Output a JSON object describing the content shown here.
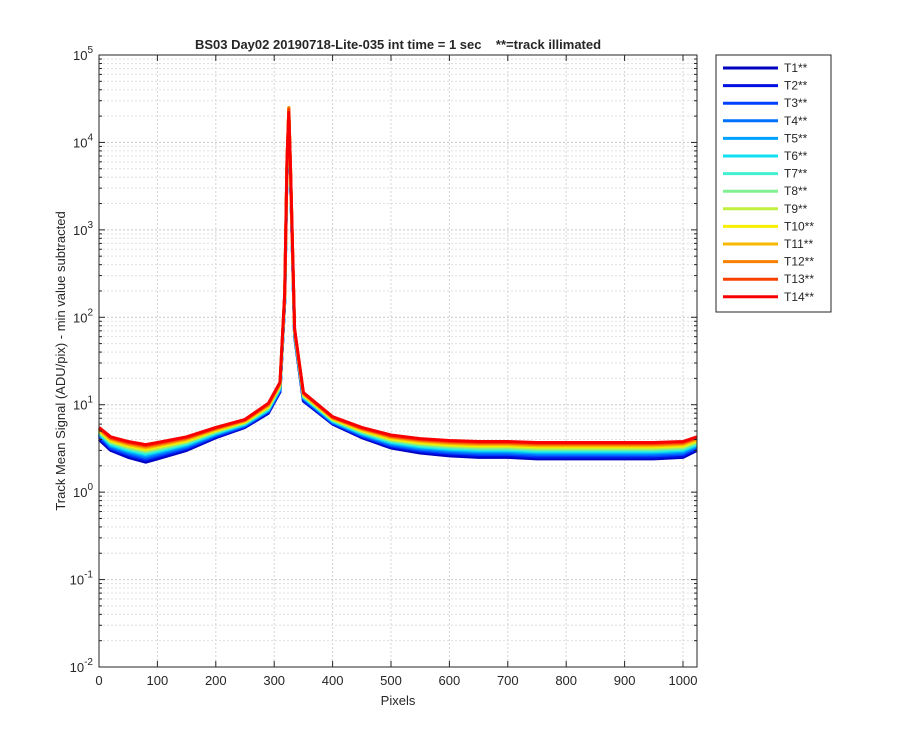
{
  "chart_data": {
    "type": "line",
    "title": "BS03 Day02 20190718-Lite-035 int time = 1 sec    **=track illimated",
    "xlabel": "Pixels",
    "ylabel": "Track Mean Signal (ADU/pix) - min value subtracted",
    "xlim": [
      0,
      1024
    ],
    "ylim": [
      0.01,
      100000
    ],
    "yscale": "log",
    "grid": true,
    "minor_grid": true,
    "legend_position": "outside-right-top",
    "x_ticks": [
      {
        "value": 0,
        "label": "0"
      },
      {
        "value": 100,
        "label": "100"
      },
      {
        "value": 200,
        "label": "200"
      },
      {
        "value": 300,
        "label": "300"
      },
      {
        "value": 400,
        "label": "400"
      },
      {
        "value": 500,
        "label": "500"
      },
      {
        "value": 600,
        "label": "600"
      },
      {
        "value": 700,
        "label": "700"
      },
      {
        "value": 800,
        "label": "800"
      },
      {
        "value": 900,
        "label": "900"
      },
      {
        "value": 1000,
        "label": "1000"
      }
    ],
    "y_ticks": [
      {
        "value": 0.01,
        "base": "10",
        "exp": "-2"
      },
      {
        "value": 0.1,
        "base": "10",
        "exp": "-1"
      },
      {
        "value": 1,
        "base": "10",
        "exp": "0"
      },
      {
        "value": 10,
        "base": "10",
        "exp": "1"
      },
      {
        "value": 100,
        "base": "10",
        "exp": "2"
      },
      {
        "value": 1000,
        "base": "10",
        "exp": "3"
      },
      {
        "value": 10000,
        "base": "10",
        "exp": "4"
      },
      {
        "value": 100000,
        "base": "10",
        "exp": "5"
      }
    ],
    "series": [
      {
        "name": "T1**",
        "color": "#0000bf",
        "x": [
          0,
          20,
          50,
          80,
          100,
          150,
          200,
          250,
          290,
          310,
          318,
          322,
          325,
          328,
          335,
          350,
          400,
          450,
          500,
          550,
          600,
          650,
          700,
          750,
          800,
          850,
          900,
          950,
          1000,
          1024
        ],
        "y": [
          4,
          3,
          2.5,
          2.2,
          2.4,
          3,
          4.2,
          5.5,
          8,
          14,
          150,
          5000,
          21000,
          4000,
          60,
          11,
          6,
          4.2,
          3.2,
          2.8,
          2.6,
          2.5,
          2.5,
          2.4,
          2.4,
          2.4,
          2.4,
          2.4,
          2.5,
          3
        ]
      },
      {
        "name": "T2**",
        "color": "#0010e0",
        "x": [
          0,
          20,
          50,
          80,
          100,
          150,
          200,
          250,
          290,
          310,
          318,
          322,
          325,
          328,
          335,
          350,
          400,
          450,
          500,
          550,
          600,
          650,
          700,
          750,
          800,
          850,
          900,
          950,
          1000,
          1024
        ],
        "y": [
          4.2,
          3.1,
          2.6,
          2.3,
          2.5,
          3.1,
          4.3,
          5.6,
          8.2,
          14,
          150,
          5200,
          21500,
          4100,
          62,
          11,
          6.1,
          4.3,
          3.3,
          2.9,
          2.7,
          2.6,
          2.6,
          2.5,
          2.5,
          2.5,
          2.5,
          2.5,
          2.6,
          3.1
        ]
      },
      {
        "name": "T3**",
        "color": "#0040ff",
        "x": [
          0,
          20,
          50,
          80,
          100,
          150,
          200,
          250,
          290,
          310,
          318,
          322,
          325,
          328,
          335,
          350,
          400,
          450,
          500,
          550,
          600,
          650,
          700,
          750,
          800,
          850,
          900,
          950,
          1000,
          1024
        ],
        "y": [
          4.4,
          3.2,
          2.7,
          2.4,
          2.6,
          3.2,
          4.4,
          5.7,
          8.4,
          14.5,
          155,
          5300,
          22000,
          4200,
          63,
          11.5,
          6.2,
          4.4,
          3.4,
          3,
          2.8,
          2.7,
          2.7,
          2.6,
          2.6,
          2.6,
          2.6,
          2.6,
          2.7,
          3.2
        ]
      },
      {
        "name": "T4**",
        "color": "#0070ff",
        "x": [
          0,
          20,
          50,
          80,
          100,
          150,
          200,
          250,
          290,
          310,
          318,
          322,
          325,
          328,
          335,
          350,
          400,
          450,
          500,
          550,
          600,
          650,
          700,
          750,
          800,
          850,
          900,
          950,
          1000,
          1024
        ],
        "y": [
          4.5,
          3.3,
          2.8,
          2.5,
          2.7,
          3.3,
          4.5,
          5.8,
          8.5,
          15,
          160,
          5400,
          22500,
          4300,
          64,
          12,
          6.3,
          4.5,
          3.5,
          3.1,
          2.9,
          2.8,
          2.8,
          2.7,
          2.7,
          2.7,
          2.7,
          2.7,
          2.8,
          3.3
        ]
      },
      {
        "name": "T5**",
        "color": "#00a0ff",
        "x": [
          0,
          20,
          50,
          80,
          100,
          150,
          200,
          250,
          290,
          310,
          318,
          322,
          325,
          328,
          335,
          350,
          400,
          450,
          500,
          550,
          600,
          650,
          700,
          750,
          800,
          850,
          900,
          950,
          1000,
          1024
        ],
        "y": [
          4.6,
          3.4,
          2.9,
          2.6,
          2.8,
          3.4,
          4.6,
          5.9,
          8.6,
          15,
          160,
          5500,
          23000,
          4400,
          65,
          12,
          6.4,
          4.6,
          3.6,
          3.2,
          3,
          2.9,
          2.9,
          2.8,
          2.8,
          2.8,
          2.8,
          2.8,
          2.9,
          3.4
        ]
      },
      {
        "name": "T6**",
        "color": "#10e0f0",
        "x": [
          0,
          20,
          50,
          80,
          100,
          150,
          200,
          250,
          290,
          310,
          318,
          322,
          325,
          328,
          335,
          350,
          400,
          450,
          500,
          550,
          600,
          650,
          700,
          750,
          800,
          850,
          900,
          950,
          1000,
          1024
        ],
        "y": [
          4.7,
          3.5,
          3,
          2.7,
          2.9,
          3.5,
          4.7,
          6,
          8.8,
          15.5,
          165,
          5600,
          23000,
          4500,
          66,
          12.2,
          6.5,
          4.7,
          3.7,
          3.3,
          3.1,
          3,
          3,
          2.9,
          2.9,
          2.9,
          2.9,
          2.9,
          3,
          3.5
        ]
      },
      {
        "name": "T7**",
        "color": "#40f0d0",
        "x": [
          0,
          20,
          50,
          80,
          100,
          150,
          200,
          250,
          290,
          310,
          318,
          322,
          325,
          328,
          335,
          350,
          400,
          450,
          500,
          550,
          600,
          650,
          700,
          750,
          800,
          850,
          900,
          950,
          1000,
          1024
        ],
        "y": [
          4.8,
          3.6,
          3.1,
          2.8,
          3,
          3.6,
          4.8,
          6.1,
          9,
          16,
          170,
          5700,
          23500,
          4600,
          67,
          12.4,
          6.6,
          4.8,
          3.8,
          3.4,
          3.2,
          3.1,
          3.1,
          3,
          3,
          3,
          3,
          3,
          3.1,
          3.6
        ]
      },
      {
        "name": "T8**",
        "color": "#80f090",
        "x": [
          0,
          20,
          50,
          80,
          100,
          150,
          200,
          250,
          290,
          310,
          318,
          322,
          325,
          328,
          335,
          350,
          400,
          450,
          500,
          550,
          600,
          650,
          700,
          750,
          800,
          850,
          900,
          950,
          1000,
          1024
        ],
        "y": [
          4.9,
          3.7,
          3.2,
          2.9,
          3.1,
          3.7,
          4.9,
          6.2,
          9.2,
          16,
          170,
          5800,
          24000,
          4700,
          68,
          12.6,
          6.7,
          4.9,
          3.9,
          3.5,
          3.3,
          3.2,
          3.2,
          3.1,
          3.1,
          3.1,
          3.1,
          3.1,
          3.2,
          3.7
        ]
      },
      {
        "name": "T9**",
        "color": "#c0f040",
        "x": [
          0,
          20,
          50,
          80,
          100,
          150,
          200,
          250,
          290,
          310,
          318,
          322,
          325,
          328,
          335,
          350,
          400,
          450,
          500,
          550,
          600,
          650,
          700,
          750,
          800,
          850,
          900,
          950,
          1000,
          1024
        ],
        "y": [
          5,
          3.8,
          3.3,
          3,
          3.2,
          3.8,
          5,
          6.3,
          9.4,
          16.5,
          175,
          5900,
          24000,
          4800,
          69,
          12.8,
          6.8,
          5,
          4,
          3.6,
          3.4,
          3.3,
          3.3,
          3.2,
          3.2,
          3.2,
          3.2,
          3.2,
          3.3,
          3.8
        ]
      },
      {
        "name": "T10**",
        "color": "#f8f000",
        "x": [
          0,
          20,
          50,
          80,
          100,
          150,
          200,
          250,
          290,
          310,
          318,
          322,
          325,
          328,
          335,
          350,
          400,
          450,
          500,
          550,
          600,
          650,
          700,
          750,
          800,
          850,
          900,
          950,
          1000,
          1024
        ],
        "y": [
          5.1,
          3.9,
          3.4,
          3.1,
          3.3,
          3.9,
          5.1,
          6.4,
          9.6,
          17,
          175,
          6000,
          24500,
          4900,
          70,
          13,
          6.9,
          5.1,
          4.1,
          3.7,
          3.5,
          3.4,
          3.4,
          3.3,
          3.3,
          3.3,
          3.3,
          3.3,
          3.4,
          3.9
        ]
      },
      {
        "name": "T11**",
        "color": "#f8b800",
        "x": [
          0,
          20,
          50,
          80,
          100,
          150,
          200,
          250,
          290,
          310,
          318,
          322,
          325,
          328,
          335,
          350,
          400,
          450,
          500,
          550,
          600,
          650,
          700,
          750,
          800,
          850,
          900,
          950,
          1000,
          1024
        ],
        "y": [
          5.2,
          4,
          3.5,
          3.2,
          3.4,
          4,
          5.2,
          6.5,
          9.8,
          17,
          180,
          6100,
          25000,
          5000,
          71,
          13.2,
          7,
          5.2,
          4.2,
          3.8,
          3.6,
          3.5,
          3.5,
          3.4,
          3.4,
          3.4,
          3.4,
          3.4,
          3.5,
          4
        ]
      },
      {
        "name": "T12**",
        "color": "#f88000",
        "x": [
          0,
          20,
          50,
          80,
          100,
          150,
          200,
          250,
          290,
          310,
          318,
          322,
          325,
          328,
          335,
          350,
          400,
          450,
          500,
          550,
          600,
          650,
          700,
          750,
          800,
          850,
          900,
          950,
          1000,
          1024
        ],
        "y": [
          5.3,
          4.1,
          3.6,
          3.3,
          3.5,
          4.1,
          5.3,
          6.6,
          10,
          17.5,
          180,
          6200,
          25000,
          5100,
          72,
          13.4,
          7.1,
          5.3,
          4.3,
          3.9,
          3.7,
          3.6,
          3.6,
          3.5,
          3.5,
          3.5,
          3.5,
          3.5,
          3.6,
          4.1
        ]
      },
      {
        "name": "T13**",
        "color": "#f84000",
        "x": [
          0,
          20,
          50,
          80,
          100,
          150,
          200,
          250,
          290,
          310,
          318,
          322,
          325,
          328,
          335,
          350,
          400,
          450,
          500,
          550,
          600,
          650,
          700,
          750,
          800,
          850,
          900,
          950,
          1000,
          1024
        ],
        "y": [
          5.4,
          4.2,
          3.7,
          3.4,
          3.6,
          4.2,
          5.4,
          6.7,
          10.2,
          18,
          185,
          6300,
          24000,
          5200,
          73,
          13.6,
          7.2,
          5.4,
          4.4,
          4,
          3.8,
          3.7,
          3.7,
          3.6,
          3.6,
          3.6,
          3.6,
          3.6,
          3.7,
          4.2
        ]
      },
      {
        "name": "T14**",
        "color": "#f80000",
        "x": [
          0,
          20,
          50,
          80,
          100,
          150,
          200,
          250,
          290,
          310,
          318,
          322,
          325,
          328,
          335,
          350,
          400,
          450,
          500,
          550,
          600,
          650,
          700,
          750,
          800,
          850,
          900,
          950,
          1000,
          1024
        ],
        "y": [
          5.5,
          4.3,
          3.8,
          3.5,
          3.7,
          4.3,
          5.5,
          6.8,
          10.4,
          18,
          190,
          6400,
          22000,
          5300,
          74,
          13.8,
          7.3,
          5.5,
          4.5,
          4.1,
          3.9,
          3.8,
          3.8,
          3.7,
          3.7,
          3.7,
          3.7,
          3.7,
          3.8,
          4.3
        ]
      }
    ]
  }
}
